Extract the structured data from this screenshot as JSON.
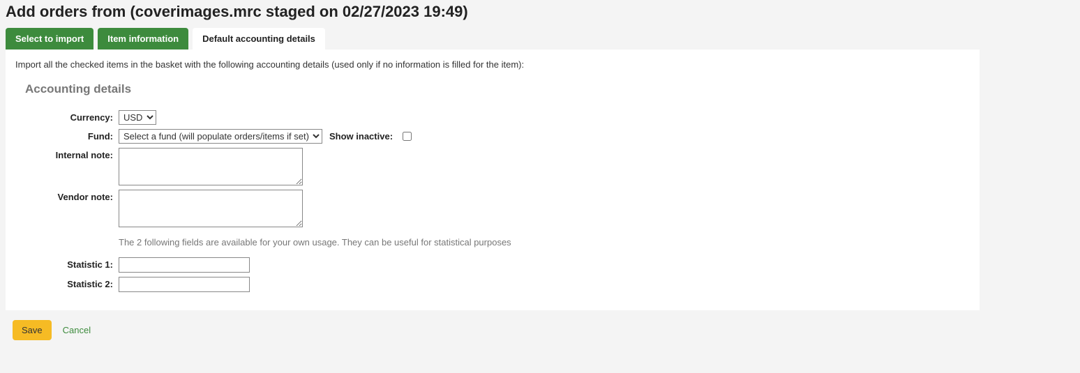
{
  "header": {
    "title": "Add orders from (coverimages.mrc staged on 02/27/2023 19:49)"
  },
  "tabs": {
    "select_to_import": "Select to import",
    "item_information": "Item information",
    "default_accounting_details": "Default accounting details"
  },
  "panel": {
    "intro": "Import all the checked items in the basket with the following accounting details (used only if no information is filled for the item):",
    "section_title": "Accounting details",
    "fields": {
      "currency_label": "Currency:",
      "currency_value": "USD",
      "fund_label": "Fund:",
      "fund_value": "Select a fund (will populate orders/items if set)",
      "show_inactive_label": "Show inactive:",
      "internal_note_label": "Internal note:",
      "internal_note_value": "",
      "vendor_note_label": "Vendor note:",
      "vendor_note_value": "",
      "hint": "The 2 following fields are available for your own usage. They can be useful for statistical purposes",
      "stat1_label": "Statistic 1:",
      "stat1_value": "",
      "stat2_label": "Statistic 2:",
      "stat2_value": ""
    }
  },
  "actions": {
    "save": "Save",
    "cancel": "Cancel"
  }
}
